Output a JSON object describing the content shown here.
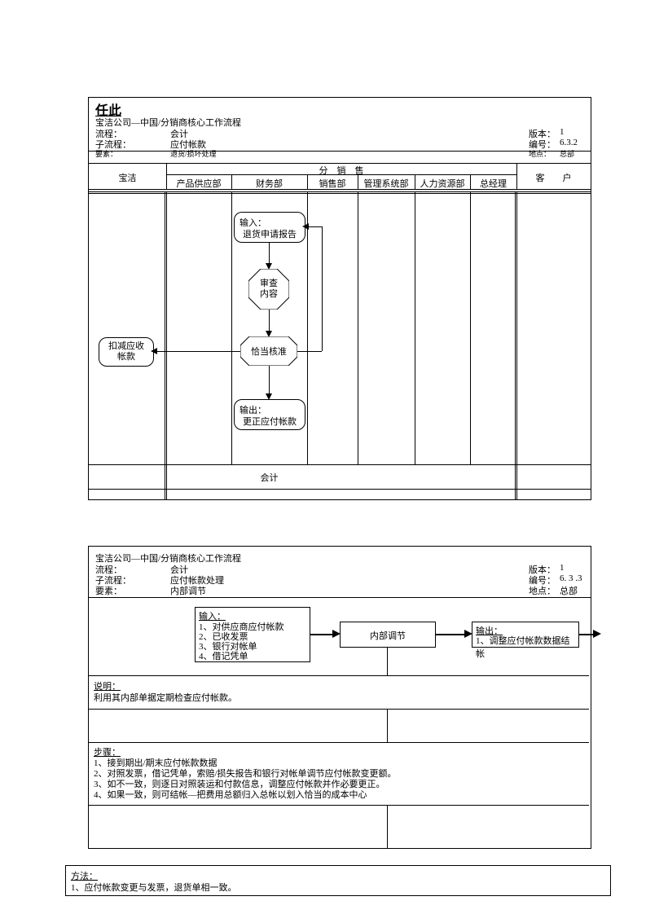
{
  "top": {
    "titleBig": "任此",
    "header": "宝洁公司—中国/分销商核心工作流程",
    "rows": {
      "r1l": "流程：",
      "r1v": "会计",
      "r2l": "子流程：",
      "r2v": "应付帐款",
      "r3l": "要素：",
      "r3v": "退货/损坏处理",
      "v1l": "版本：",
      "v1v": "1",
      "v2l": "编号：",
      "v2v": "6.3.2",
      "v3l": "地点：",
      "v3v": "总部"
    },
    "cols": {
      "c0": "宝洁",
      "groupTitle": "分　销　售",
      "c1": "产品供应部",
      "c2": "财务部",
      "c3": "销售部",
      "c4": "管理系统部",
      "c5": "人力资源部",
      "c6": "总经理",
      "cLast": "客　　户"
    },
    "flow": {
      "inputT": "输入：",
      "inputL": "退货申请报告",
      "check": "审查\n内容",
      "approve": "恰当核准",
      "outT": "输出：",
      "outL": "更正应付帐款",
      "deduct": "扣减应收\n帐款",
      "footer": "会计"
    }
  },
  "bottom": {
    "header": "宝洁公司—中国/分销商核心工作流程",
    "rows": {
      "r1l": "流程：",
      "r1v": "会计",
      "r2l": "子流程：",
      "r2v": "应付帐款处理",
      "r3l": "要素：",
      "r3v": "内部调节",
      "v1l": "版本：",
      "v1v": "1",
      "v2l": "编号：",
      "v2v": "6. 3 .3",
      "v3l": "地点：",
      "v3v": "总部"
    },
    "inputT": "输入：",
    "inputLines": [
      "1、对供应商应付帐款",
      "2、已收发票",
      "3、银行对帐单",
      "4、借记凭单"
    ],
    "procLabel": "内部调节",
    "outT": "输出：",
    "outLine": "1、调整应付帐款数据结帐",
    "desc": {
      "h": "说明：",
      "l1": "利用其内部单据定期检查应付帐款。"
    },
    "steps": {
      "h": "步骤：",
      "l1": "1、接到期出/期末应付帐款数据",
      "l2": "2、对照发票，借记凭单，索赔/损失报告和银行对帐单调节应付帐款变更额。",
      "l3": "3、如不一致，则逐日对照装运和付款信息，调整应付帐款并作必要更正。",
      "l4": "4、如果一致，则可结帐—把费用总额归入总帐以划入恰当的成本中心"
    },
    "method": {
      "h": "方法：",
      "l1": "1、应付帐款变更与发票，退货单相一致。"
    }
  }
}
